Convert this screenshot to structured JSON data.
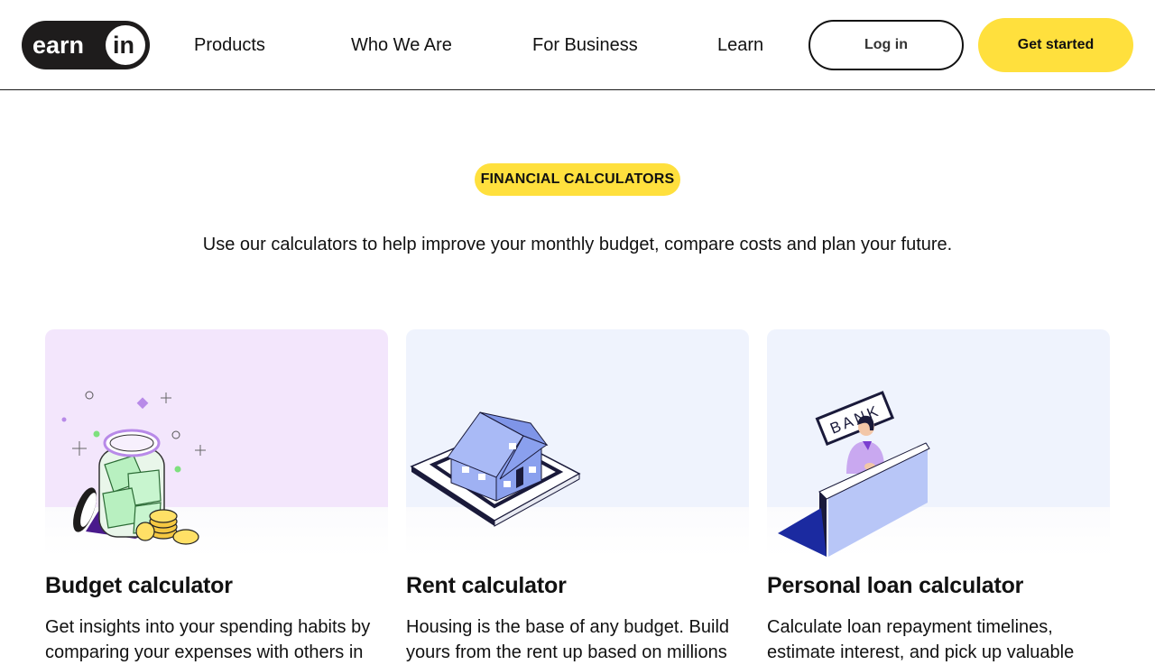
{
  "brand": {
    "logo_text_left": "earn",
    "logo_text_right": "in",
    "accent": "#ffe03d"
  },
  "nav": {
    "items": [
      {
        "label": "Products"
      },
      {
        "label": "Who We Are"
      },
      {
        "label": "For Business"
      },
      {
        "label": "Learn"
      }
    ],
    "login_label": "Log in",
    "get_started_label": "Get started"
  },
  "hero": {
    "badge": "FINANCIAL CALCULATORS",
    "subtitle": "Use our calculators to help improve your monthly budget, compare costs and plan your future."
  },
  "cards": [
    {
      "title": "Budget calculator",
      "description": "Get insights into your spending habits by comparing your expenses with others in",
      "illustration": "money-jar-icon",
      "bg_color": "#f3e6fc"
    },
    {
      "title": "Rent calculator",
      "description": "Housing is the base of any budget. Build yours from the rent up based on millions",
      "illustration": "house-icon",
      "bg_color": "#eff3fd"
    },
    {
      "title": "Personal loan calculator",
      "description": "Calculate loan repayment timelines, estimate interest, and pick up valuable",
      "illustration": "bank-teller-icon",
      "sign_text": "BANK",
      "bg_color": "#eff3fd"
    }
  ]
}
